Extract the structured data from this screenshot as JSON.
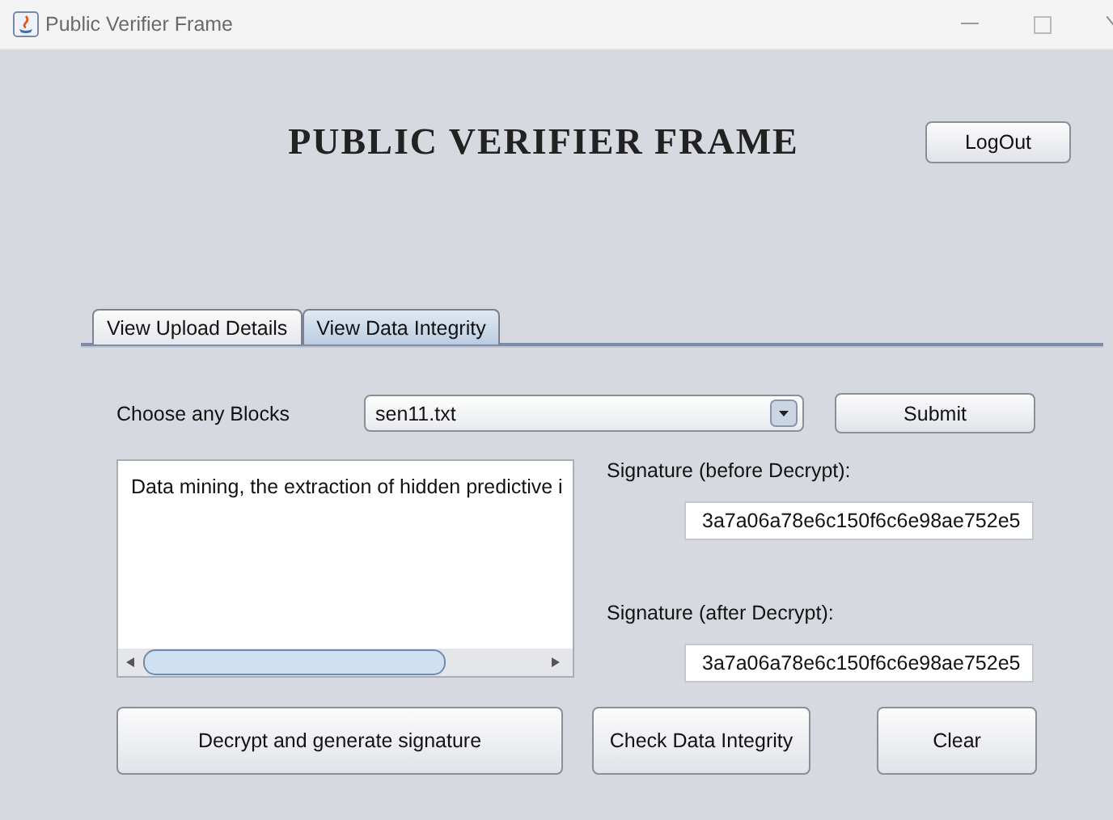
{
  "window": {
    "title": "Public Verifier Frame"
  },
  "heading": "PUBLIC VERIFIER FRAME",
  "logout_button": "LogOut",
  "tabs": [
    {
      "label": "View Upload Details",
      "selected": false
    },
    {
      "label": "View Data Integrity",
      "selected": true
    }
  ],
  "block_chooser": {
    "label": "Choose any Blocks",
    "value": "sen11.txt"
  },
  "submit_button": "Submit",
  "content_text": "Data mining, the extraction of hidden predictive i",
  "signatures": [
    {
      "label": "Signature (before Decrypt):",
      "value": "3a7a06a78e6c150f6c6e98ae752e5"
    },
    {
      "label": "Signature (after Decrypt):",
      "value": "3a7a06a78e6c150f6c6e98ae752e5"
    }
  ],
  "buttons": [
    "Decrypt and generate signature",
    "Check Data Integrity",
    "Clear"
  ]
}
